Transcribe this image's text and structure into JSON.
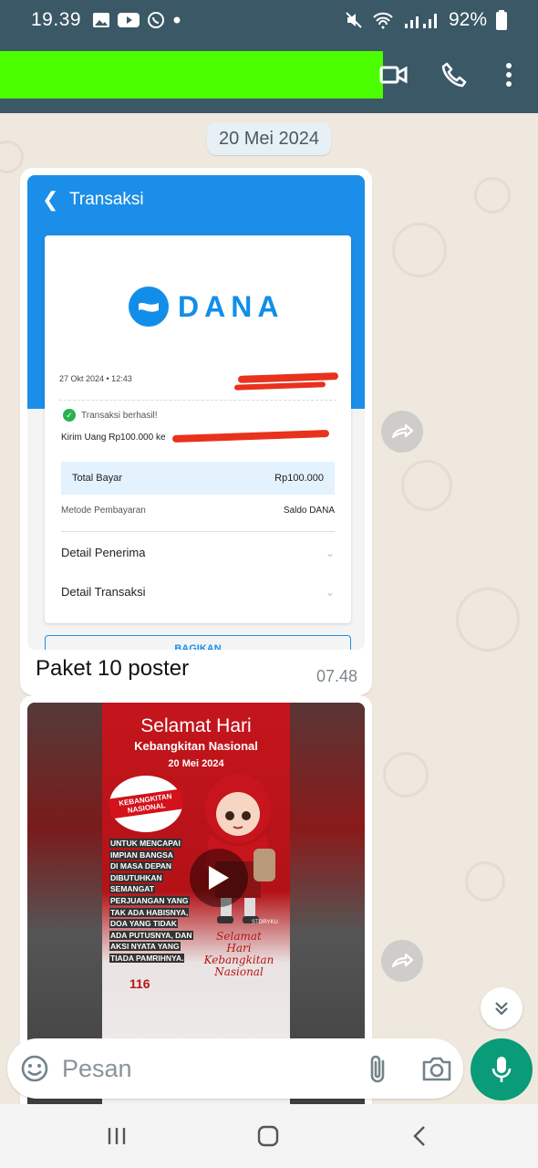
{
  "status_bar": {
    "time": "19.39",
    "battery": "92%",
    "icons": [
      "gallery-icon",
      "youtube-icon",
      "whatsapp-icon",
      "dot-icon",
      "mute-icon",
      "wifi-icon",
      "signal-icon",
      "battery-icon"
    ]
  },
  "header": {
    "icons": [
      "video-call-icon",
      "voice-call-icon",
      "more-options-icon"
    ],
    "accent": "#3a5866"
  },
  "chat": {
    "date_label": "20 Mei 2024",
    "messages": [
      {
        "type": "image",
        "caption": "Paket 10 poster",
        "time": "07.48",
        "image": {
          "screen_title": "Transaksi",
          "brand": "DANA",
          "date": "27 Okt 2024 • 12:43",
          "status": "Transaksi berhasil!",
          "send_text": "Kirim Uang Rp100.000 ke",
          "total_label": "Total Bayar",
          "total_value": "Rp100.000",
          "method_label": "Metode Pembayaran",
          "method_value": "Saldo DANA",
          "detail_recipient": "Detail Penerima",
          "detail_transaction": "Detail Transaksi",
          "share_button": "BAGIKAN"
        }
      },
      {
        "type": "video",
        "poster": {
          "title_line1": "Selamat Hari",
          "title_line2": "Kebangkitan Nasional",
          "date": "20 Mei 2024",
          "badge": "KEBANGKITAN NASIONAL",
          "message": [
            "UNTUK MENCAPAI",
            "IMPIAN BANGSA",
            "DI MASA DEPAN",
            "DIBUTUHKAN",
            "SEMANGAT",
            "PERJUANGAN YANG",
            "TAK ADA HABISNYA,",
            "DOA YANG TIDAK",
            "ADA PUTUSNYA, DAN",
            "AKSI NYATA YANG",
            "TIADA PAMRIHNYA."
          ],
          "tag": "STORYKU",
          "script_line1": "Selamat",
          "script_line2": "Hari Kebangkitan",
          "script_line3": "Nasional",
          "anniversary": "116"
        }
      }
    ]
  },
  "composer": {
    "placeholder": "Pesan",
    "value": ""
  },
  "colors": {
    "dana_blue": "#1a8ee8",
    "send_green": "#0a9b78",
    "chat_bg": "#efe8de"
  }
}
